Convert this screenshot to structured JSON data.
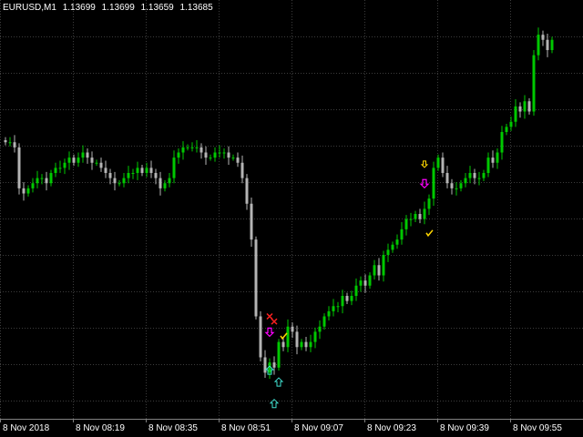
{
  "chart_header": {
    "symbol": "EURUSD,M1",
    "open": "1.13699",
    "high": "1.13699",
    "low": "1.13659",
    "close": "1.13685"
  },
  "colors": {
    "background": "#000000",
    "grid": "#3c3c3c",
    "bull": "#00c800",
    "bear": "#b4b4b4",
    "text": "#ffffff",
    "arrow_buy": "#40e0d0",
    "arrow_sell": "#ff00ff",
    "arrow_exit": "#ffd700",
    "cross": "#ff2020"
  },
  "chart_data": {
    "type": "candlestick",
    "x_tick_labels": [
      "8 Nov 2018",
      "8 Nov 08:19",
      "8 Nov 08:35",
      "8 Nov 08:51",
      "8 Nov 09:07",
      "8 Nov 09:23",
      "8 Nov 09:39",
      "8 Nov 09:55"
    ],
    "grid": true,
    "closes": [
      1.1367,
      1.1367,
      1.1366,
      1.1358,
      1.1357,
      1.1358,
      1.1359,
      1.136,
      1.136,
      1.1359,
      1.1361,
      1.1362,
      1.1362,
      1.1363,
      1.1364,
      1.1363,
      1.1364,
      1.1365,
      1.1364,
      1.1363,
      1.1363,
      1.1362,
      1.1361,
      1.136,
      1.1359,
      1.1359,
      1.136,
      1.1361,
      1.1361,
      1.1362,
      1.1361,
      1.1362,
      1.1361,
      1.136,
      1.1358,
      1.1359,
      1.136,
      1.1364,
      1.1365,
      1.1366,
      1.1366,
      1.1366,
      1.1366,
      1.1365,
      1.1364,
      1.1364,
      1.1365,
      1.1365,
      1.1365,
      1.1364,
      1.1364,
      1.1363,
      1.136,
      1.1355,
      1.1348,
      1.1333,
      1.1325,
      1.1322,
      1.1324,
      1.1323,
      1.1328,
      1.1327,
      1.1331,
      1.133,
      1.1327,
      1.1328,
      1.1327,
      1.1328,
      1.133,
      1.1331,
      1.1333,
      1.1334,
      1.1335,
      1.1335,
      1.1337,
      1.1336,
      1.1337,
      1.1339,
      1.134,
      1.1339,
      1.1341,
      1.1343,
      1.1341,
      1.1345,
      1.1346,
      1.1347,
      1.1348,
      1.135,
      1.1352,
      1.1352,
      1.1353,
      1.1352,
      1.1354,
      1.1356,
      1.1362,
      1.1364,
      1.1361,
      1.1359,
      1.1358,
      1.1358,
      1.1359,
      1.136,
      1.1361,
      1.136,
      1.136,
      1.1361,
      1.1364,
      1.1363,
      1.1365,
      1.1369,
      1.137,
      1.1371,
      1.1374,
      1.1373,
      1.1375,
      1.1373,
      1.1384,
      1.1388,
      1.1387,
      1.1385,
      1.1387
    ],
    "markers": [
      {
        "type": "cross",
        "bar": 58,
        "price": 1.1333
      },
      {
        "type": "cross",
        "bar": 59,
        "price": 1.1332
      },
      {
        "type": "sell_arrow",
        "bar": 58,
        "price": 1.133
      },
      {
        "type": "buy_arrow",
        "bar": 58,
        "price": 1.13224
      },
      {
        "type": "buy_arrow",
        "bar": 60,
        "price": 1.13201
      },
      {
        "type": "buy_arrow",
        "bar": 59,
        "price": 1.13159
      },
      {
        "type": "exit_check",
        "bar": 61,
        "price": 1.13292
      },
      {
        "type": "exit_arrow",
        "bar": 92,
        "price": 1.13628
      },
      {
        "type": "sell_arrow",
        "bar": 92,
        "price": 1.1359
      },
      {
        "type": "exit_check",
        "bar": 93,
        "price": 1.13493
      }
    ]
  }
}
